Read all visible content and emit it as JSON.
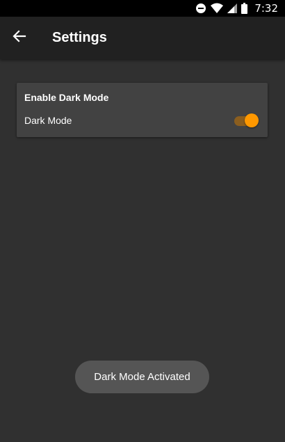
{
  "status_bar": {
    "time": "7:32",
    "icons": [
      "do-not-disturb-icon",
      "wifi-icon",
      "signal-icon",
      "battery-icon"
    ]
  },
  "app_bar": {
    "back_icon": "arrow-back-icon",
    "title": "Settings"
  },
  "card": {
    "title": "Enable Dark Mode",
    "setting_label": "Dark Mode",
    "switch_on": true
  },
  "toast": {
    "text": "Dark Mode Activated"
  },
  "colors": {
    "background": "#303030",
    "app_bar": "#212121",
    "card": "#424242",
    "accent": "#ff9800",
    "toast": "#555555"
  }
}
